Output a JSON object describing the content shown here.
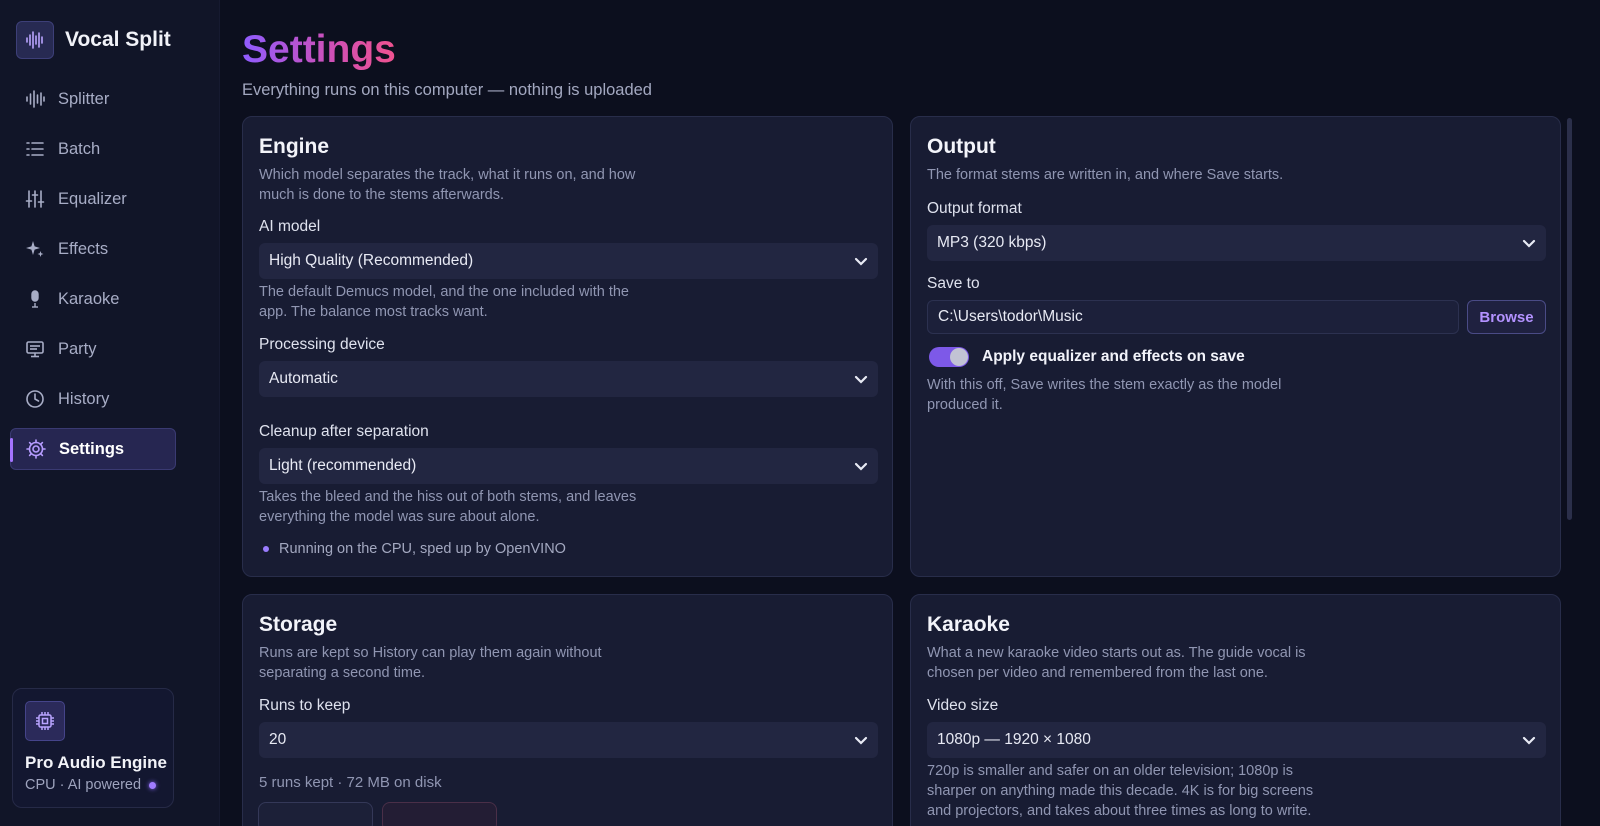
{
  "app": {
    "name": "Vocal Split"
  },
  "sidebar": {
    "items": [
      {
        "label": "Splitter",
        "icon": "waveform-icon"
      },
      {
        "label": "Batch",
        "icon": "list-icon"
      },
      {
        "label": "Equalizer",
        "icon": "sliders-icon"
      },
      {
        "label": "Effects",
        "icon": "sparkle-icon"
      },
      {
        "label": "Karaoke",
        "icon": "microphone-icon"
      },
      {
        "label": "Party",
        "icon": "monitor-icon"
      },
      {
        "label": "History",
        "icon": "clock-icon"
      },
      {
        "label": "Settings",
        "icon": "gear-icon",
        "active": true
      }
    ],
    "engine_card": {
      "title": "Pro Audio Engine",
      "subtitle": "CPU · AI powered"
    }
  },
  "header": {
    "title": "Settings",
    "subtitle": "Everything runs on this computer — nothing is uploaded"
  },
  "engine": {
    "title": "Engine",
    "description": "Which model separates the track, what it runs on, and how much is done to the stems afterwards.",
    "ai_model_label": "AI model",
    "ai_model_value": "High Quality (Recommended)",
    "ai_model_help": "The default Demucs model, and the one included with the app. The balance most tracks want.",
    "device_label": "Processing device",
    "device_value": "Automatic",
    "cleanup_label": "Cleanup after separation",
    "cleanup_value": "Light (recommended)",
    "cleanup_help": "Takes the bleed and the hiss out of both stems, and leaves everything the model was sure about alone.",
    "status": "Running on the CPU, sped up by OpenVINO"
  },
  "output": {
    "title": "Output",
    "description": "The format stems are written in, and where Save starts.",
    "format_label": "Output format",
    "format_value": "MP3 (320 kbps)",
    "save_to_label": "Save to",
    "save_to_value": "C:\\Users\\todor\\Music",
    "browse_label": "Browse",
    "apply_label": "Apply equalizer and effects on save",
    "apply_on": true,
    "apply_help": "With this off, Save writes the stem exactly as the model produced it."
  },
  "storage": {
    "title": "Storage",
    "description": "Runs are kept so History can play them again without separating a second time.",
    "runs_label": "Runs to keep",
    "runs_value": "20",
    "runs_info": "5 runs kept · 72 MB on disk"
  },
  "karaoke": {
    "title": "Karaoke",
    "description": "What a new karaoke video starts out as. The guide vocal is chosen per video and remembered from the last one.",
    "video_size_label": "Video size",
    "video_size_value": "1080p — 1920 × 1080",
    "video_size_help": "720p is smaller and safer on an older television; 1080p is sharper on anything made this decade. 4K is for big screens and projectors, and takes about three times as long to write."
  },
  "colors": {
    "accent": "#a474ff",
    "background": "#0c0f1e",
    "card": "#181c33"
  }
}
